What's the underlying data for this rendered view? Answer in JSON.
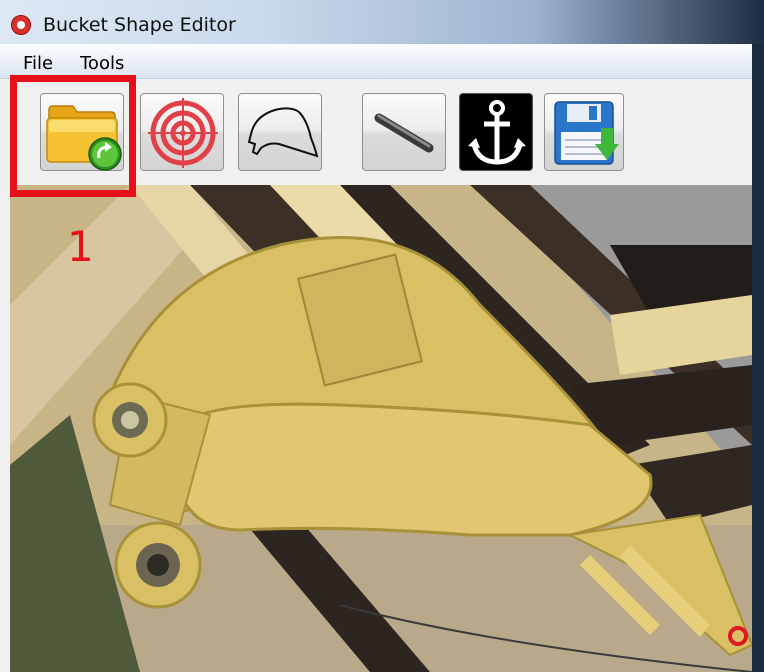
{
  "window": {
    "title": "Bucket Shape Editor",
    "app_icon": "app-logo-icon"
  },
  "menu": {
    "items": [
      "File",
      "Tools"
    ]
  },
  "toolbar": {
    "buttons": [
      {
        "name": "open-folder-button",
        "icon": "folder-open-icon"
      },
      {
        "name": "target-button",
        "icon": "target-icon"
      },
      {
        "name": "bucket-outline-button",
        "icon": "bucket-outline-icon"
      },
      {
        "name": "pin-button",
        "icon": "pin-icon"
      },
      {
        "name": "anchor-button",
        "icon": "anchor-icon"
      },
      {
        "name": "save-button",
        "icon": "save-icon"
      }
    ]
  },
  "annotation": {
    "step_label": "1",
    "highlight_color": "#e5101a"
  },
  "canvas": {
    "image": "bucket-photo",
    "bucket_color": "#d9c065",
    "marker_color": "#e01822"
  }
}
